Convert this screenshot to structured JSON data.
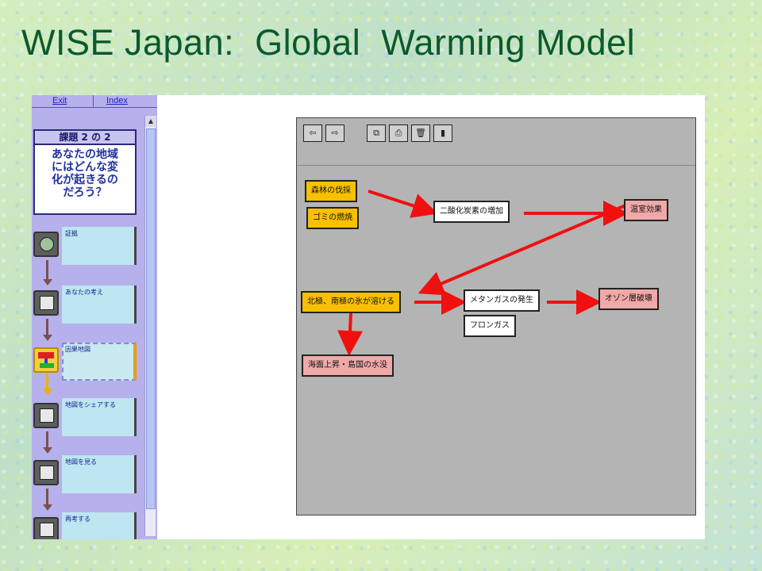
{
  "slide": {
    "title": "WISE Japan:  Global  Warming Model"
  },
  "nav": {
    "exit_label": "Exit",
    "index_label": "Index"
  },
  "lesson": {
    "header": "課題 2 の 2",
    "question_lines": [
      "あなたの地域",
      "にはどんな変",
      "化が起きるの",
      "だろう？"
    ]
  },
  "steps": [
    {
      "label": "証拠",
      "icon": "globe-icon",
      "active": false
    },
    {
      "label": "あなたの考え",
      "icon": "note-icon",
      "active": false
    },
    {
      "label": "因果地図",
      "icon": "map-tool-icon",
      "active": true
    },
    {
      "label": "地図をシェアする",
      "icon": "people-icon",
      "active": false
    },
    {
      "label": "地図を見る",
      "icon": "people-icon",
      "active": false
    },
    {
      "label": "再考する",
      "icon": "note-icon",
      "active": false
    }
  ],
  "toolbar": [
    {
      "name": "open-icon",
      "glyph": "⇦"
    },
    {
      "name": "forward-icon",
      "glyph": "⇨"
    },
    {
      "name": "copy-icon",
      "glyph": "⧉"
    },
    {
      "name": "print-icon",
      "glyph": "⎙"
    },
    {
      "name": "trash-icon",
      "glyph": "🗑"
    },
    {
      "name": "info-icon",
      "glyph": "▮"
    }
  ],
  "diagram": {
    "nodes": [
      {
        "id": "deforestation",
        "label": "森林の伐採",
        "color": "yellow"
      },
      {
        "id": "garbage",
        "label": "ゴミの燃焼",
        "color": "yellow"
      },
      {
        "id": "co2",
        "label": "二酸化炭素の増加",
        "color": "white"
      },
      {
        "id": "greenhouse",
        "label": "温室効果",
        "color": "pink"
      },
      {
        "id": "ice",
        "label": "北極、南極の氷が溶ける",
        "color": "yellow"
      },
      {
        "id": "methane",
        "label": "メタンガスの発生",
        "color": "white"
      },
      {
        "id": "ozone",
        "label": "オゾン層破壊",
        "color": "pink"
      },
      {
        "id": "freon",
        "label": "フロンガス",
        "color": "white"
      },
      {
        "id": "sealevel",
        "label": "海面上昇・島国の水没",
        "color": "pink"
      }
    ],
    "arrow_color": "#f01010"
  },
  "colors": {
    "title": "#0a5a2e",
    "arrow": "#f01010",
    "node_yellow": "#f8c000",
    "node_pink": "#f0a8a8"
  }
}
